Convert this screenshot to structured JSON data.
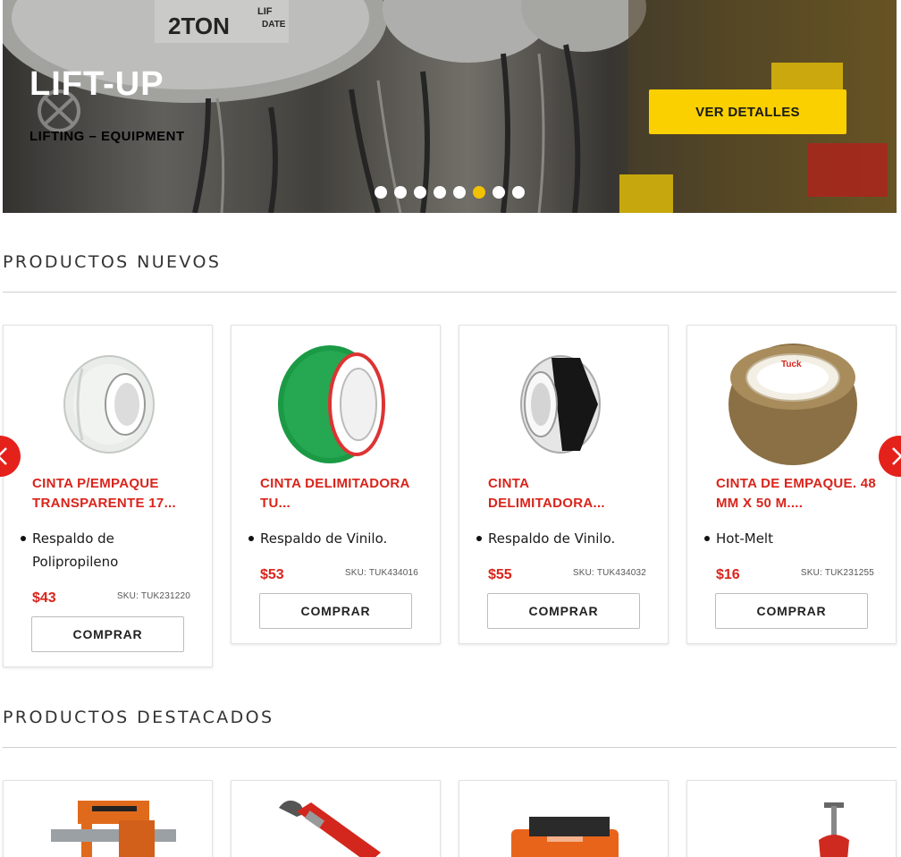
{
  "hero": {
    "brand_name": "LIFT-UP",
    "brand_tagline": "LIFTING – EQUIPMENT",
    "cta_label": "VER DETALLES",
    "slides_count": 8,
    "active_slide": 6,
    "decor_text": [
      "2TON",
      "LIF",
      "DATE"
    ],
    "colors": {
      "cta": "#fad000",
      "active_dot": "#f2c200"
    }
  },
  "sections": {
    "new_title": "PRODUCTOS NUEVOS",
    "featured_title": "PRODUCTOS DESTACADOS"
  },
  "new_products": [
    {
      "name": "CINTA P/EMPAQUE TRANSPARENTE 17...",
      "feature": "Respaldo de Polipropileno",
      "price": "$43",
      "sku": "SKU: TUK231220",
      "buy_label": "COMPRAR",
      "image": "clear-tape"
    },
    {
      "name": "CINTA DELIMITADORA TU...",
      "feature": "Respaldo de Vinilo.",
      "price": "$53",
      "sku": "SKU: TUK434016",
      "buy_label": "COMPRAR",
      "image": "green-tape"
    },
    {
      "name": "CINTA DELIMITADORA...",
      "feature": "Respaldo de Vinilo.",
      "price": "$55",
      "sku": "SKU: TUK434032",
      "buy_label": "COMPRAR",
      "image": "black-white-tape"
    },
    {
      "name": "CINTA DE EMPAQUE. 48 MM X 50 M....",
      "feature": "Hot-Melt",
      "price": "$16",
      "sku": "SKU: TUK231255",
      "buy_label": "COMPRAR",
      "image": "brown-tape",
      "tape_brand": "Tuck"
    }
  ],
  "featured_products": [
    {
      "image": "band-saw"
    },
    {
      "image": "pipe-wrench"
    },
    {
      "image": "orange-tool"
    },
    {
      "image": "pipe-cutter"
    }
  ],
  "nav": {
    "prev_icon": "chevron-left-icon",
    "next_icon": "chevron-right-icon"
  },
  "colors": {
    "accent": "#d9241b",
    "arrow_bg": "#e4221b"
  }
}
